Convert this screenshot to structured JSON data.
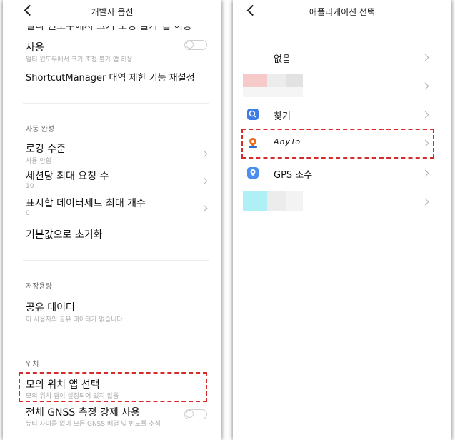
{
  "left": {
    "title": "개발자 옵션",
    "partial_text": "멀티 윈도우에서 크기 조정 불가 앱 허용",
    "multiwindow_title": "사용",
    "multiwindow_sub": "멀티 윈도우에서 크기 조정 불가 앱 허용",
    "shortcut_reset": "ShortcutManager 대역 제한 기능 재설정",
    "autofill_section": "자동 완성",
    "logging_title": "로깅 수준",
    "logging_sub": "사용 안함",
    "max_requests_title": "세션당 최대 요청 수",
    "max_requests_value": "10",
    "max_datasets_title": "표시할 데이터세트 최대 개수",
    "max_datasets_value": "0",
    "reset_defaults": "기본값으로 초기화",
    "storage_section": "저장용량",
    "shared_data_title": "공유 데이터",
    "shared_data_sub": "이 사용자의 공유 데이터가 없습니다.",
    "location_section": "위치",
    "mock_location_title": "모의 위치 앱 선택",
    "mock_location_sub": "모의 위치 앱이 설정되어 있지 않음",
    "gnss_title": "전체 GNSS 측정 강제 사용",
    "gnss_sub": "듀티 사이클 없이 모든 GNSS 배열 및 빈도를 추적"
  },
  "right": {
    "title": "애플리케이션 선택",
    "items": [
      {
        "label": "없음",
        "icon": "none"
      },
      {
        "label": "",
        "icon": "blurred-app"
      },
      {
        "label": "찾기",
        "icon": "find-icon"
      },
      {
        "label": "AnyTo",
        "icon": "anyto-icon"
      },
      {
        "label": "GPS 조수",
        "icon": "gps-assistant-icon"
      },
      {
        "label": "",
        "icon": "blurred-app"
      }
    ]
  },
  "colors": {
    "highlight": "#d52b2b",
    "find_icon": "#3d7be6",
    "gps_icon": "#4a8ff0",
    "anyto_orange": "#f06a1e",
    "anyto_blue": "#2a6fd6"
  }
}
